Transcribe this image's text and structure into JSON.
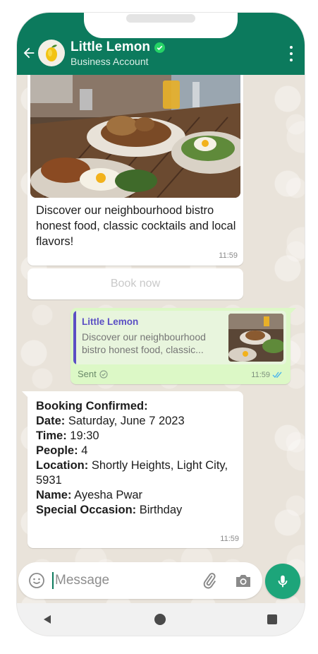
{
  "header": {
    "contact_name": "Little Lemon",
    "contact_subtitle": "Business Account",
    "icons": [
      "back-arrow-icon",
      "avatar-lemon",
      "verified-icon",
      "more-options-icon"
    ],
    "color": "#0c7a5d"
  },
  "messages": {
    "promo": {
      "text": "Discover our neighbourhood bistro honest food, classic cocktails and local flavors!",
      "time": "11:59",
      "button_label": "Book now"
    },
    "sent": {
      "quote_name": "Little Lemon",
      "quote_text": "Discover our neighbourhood bistro honest food, classic...",
      "status": "Sent",
      "time": "11:59"
    },
    "confirmation": {
      "heading": "Booking Confirmed:",
      "date_label": "Date:",
      "date_value": " Saturday, June 7 2023",
      "time_label": "Time:",
      "time_value": " 19:30",
      "people_label": "People:",
      "people_value": " 4",
      "location_label": "Location:",
      "location_value": " Shortly Heights, Light City, 5931",
      "name_label": "Name:",
      "name_value": " Ayesha Pwar",
      "occasion_label": "Special Occasion:",
      "occasion_value": " Birthday",
      "time": "11:59"
    }
  },
  "composer": {
    "placeholder": "Message",
    "icons": [
      "emoji-icon",
      "attach-icon",
      "camera-icon",
      "mic-icon"
    ],
    "accent": "#1da57a"
  },
  "navbar": {
    "icons": [
      "nav-back-icon",
      "nav-home-icon",
      "nav-recent-icon"
    ]
  }
}
